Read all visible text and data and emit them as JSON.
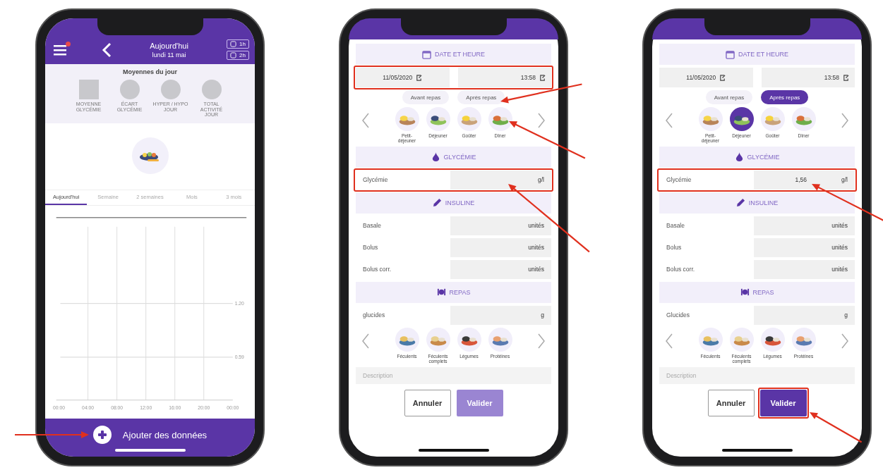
{
  "phones": [
    {
      "kind": "dashboard",
      "header": {
        "title": "Aujourd'hui",
        "subtitle": "lundi 11 mai",
        "notification": true,
        "timers": [
          "1h",
          "2h"
        ]
      },
      "summary": {
        "title": "Moyennes du jour",
        "stats": [
          {
            "kind": "square",
            "label": "MOYENNE GLYCÉMIE"
          },
          {
            "kind": "circle",
            "label": "ÉCART GLYCÉMIE"
          },
          {
            "kind": "circle",
            "label": "HYPER / HYPO JOUR"
          },
          {
            "kind": "circle",
            "label": "TOTAL ACTIVITÉ JOUR"
          }
        ]
      },
      "tabs": [
        {
          "label": "Aujourd'hui",
          "selected": true
        },
        {
          "label": "Semaine",
          "selected": false
        },
        {
          "label": "2 semaines",
          "selected": false
        },
        {
          "label": "Mois",
          "selected": false
        },
        {
          "label": "3 mois",
          "selected": false
        }
      ],
      "chart": {
        "y_labels": [
          "1.20",
          "0.59"
        ],
        "x_labels": [
          "00:00",
          "04:00",
          "08:00",
          "12:00",
          "16:00",
          "20:00",
          "00:00"
        ]
      },
      "add_button": {
        "label": "Ajouter des données",
        "arrow": true
      }
    },
    {
      "kind": "form",
      "date_time": {
        "heading": "DATE ET HEURE",
        "date": "11/05/2020",
        "time": "13:58",
        "highlighted": true
      },
      "meal_timing": [
        {
          "label": "Avant repas",
          "selected": false
        },
        {
          "label": "Après repas",
          "selected": false,
          "arrow": true
        }
      ],
      "meals": [
        {
          "label": "Petit-déjeuner",
          "selected": false
        },
        {
          "label": "Déjeuner",
          "selected": false
        },
        {
          "label": "Goûter",
          "selected": false
        },
        {
          "label": "Dîner",
          "selected": false,
          "arrow": true
        }
      ],
      "glycemia": {
        "heading": "GLYCÉMIE",
        "label": "Glycémie",
        "unit": "g/l",
        "highlighted": true,
        "arrow": true
      },
      "insulin": {
        "heading": "INSULINE",
        "rows": [
          {
            "label": "Basale",
            "unit": "unités"
          },
          {
            "label": "Bolus",
            "unit": "unités"
          },
          {
            "label": "Bolus corr.",
            "unit": "unités"
          }
        ]
      },
      "meal_section": {
        "heading": "REPAS",
        "carbs": {
          "label": "glucides",
          "unit": "g"
        },
        "food_groups": [
          "Féculents",
          "Féculents complets",
          "Légumes",
          "Protéines"
        ]
      },
      "description": {
        "placeholder": "Description"
      },
      "cancel_button": {
        "label": "Annuler"
      },
      "confirm_button": {
        "label": "Valider",
        "disabled": true
      }
    },
    {
      "kind": "form",
      "date_time": {
        "heading": "DATE ET HEURE",
        "date": "11/05/2020",
        "time": "13:58"
      },
      "meal_timing": [
        {
          "label": "Avant repas",
          "selected": false
        },
        {
          "label": "Après repas",
          "selected": true
        }
      ],
      "meals": [
        {
          "label": "Petit-déjeuner",
          "selected": false
        },
        {
          "label": "Déjeuner",
          "selected": true
        },
        {
          "label": "Goûter",
          "selected": false
        },
        {
          "label": "Dîner",
          "selected": false
        }
      ],
      "glycemia": {
        "heading": "GLYCÉMIE",
        "label": "Glycémie",
        "value": "1,56",
        "unit": "g/l",
        "highlighted": true,
        "arrow": true
      },
      "insulin": {
        "heading": "INSULINE",
        "rows": [
          {
            "label": "Basale",
            "unit": "unités"
          },
          {
            "label": "Bolus",
            "unit": "unités"
          },
          {
            "label": "Bolus corr.",
            "unit": "unités"
          }
        ]
      },
      "meal_section": {
        "heading": "REPAS",
        "carbs": {
          "label": "Glucides",
          "unit": "g"
        },
        "food_groups": [
          "Féculents",
          "Féculents complets",
          "Légumes",
          "Protéines"
        ]
      },
      "description": {
        "placeholder": "Description"
      },
      "cancel_button": {
        "label": "Annuler"
      },
      "confirm_button": {
        "label": "Valider",
        "disabled": false,
        "highlighted": true,
        "arrow": true
      }
    }
  ]
}
